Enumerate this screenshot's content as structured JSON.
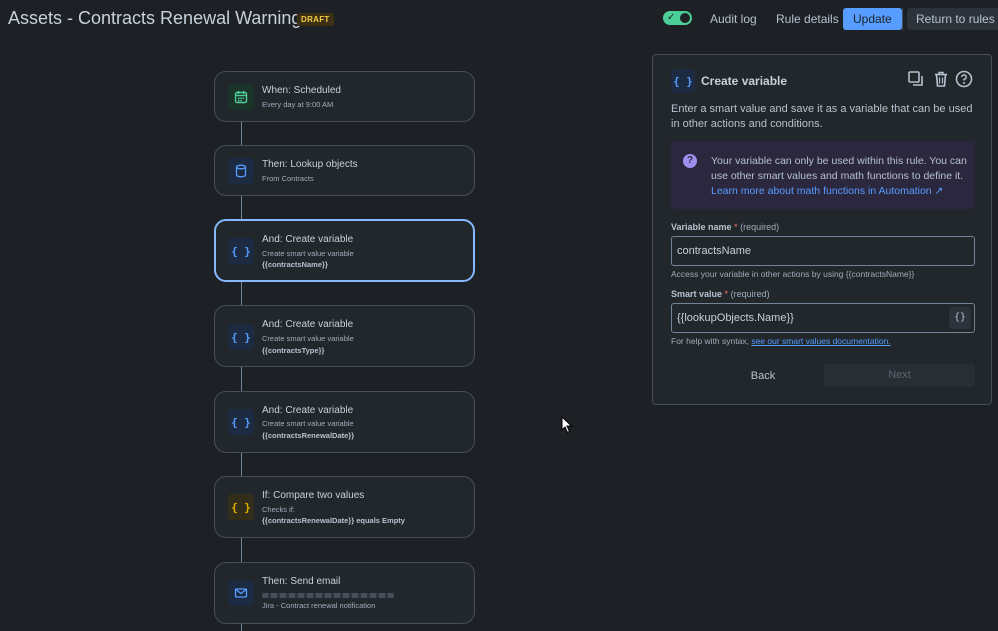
{
  "header": {
    "title": "Assets - Contracts Renewal Warning",
    "badge": "DRAFT",
    "toggle_enabled": true,
    "audit_log_label": "Audit log",
    "rule_details_label": "Rule details",
    "update_label": "Update",
    "return_label": "Return to rules"
  },
  "flow": {
    "nodes": [
      {
        "title": "When: Scheduled",
        "subtitle": "Every day at 9:00 AM",
        "icon": "calendar-icon"
      },
      {
        "title": "Then: Lookup objects",
        "subtitle": "From Contracts",
        "icon": "database-icon"
      },
      {
        "title": "And: Create variable",
        "subtitle": "Create smart value variable",
        "value": "{{contractsName}}",
        "icon": "braces-icon",
        "selected": true
      },
      {
        "title": "And: Create variable",
        "subtitle": "Create smart value variable",
        "value": "{{contractsType}}",
        "icon": "braces-icon"
      },
      {
        "title": "And: Create variable",
        "subtitle": "Create smart value variable",
        "value": "{{contractsRenewalDate}}",
        "icon": "braces-icon"
      },
      {
        "title": "If: Compare two values",
        "subtitle": "Checks if:",
        "value": "{{contractsRenewalDate}} equals Empty",
        "icon": "braces-icon"
      },
      {
        "title": "Then: Send email",
        "subtitle": "Jira - Contract renewal notification",
        "icon": "email-icon"
      }
    ]
  },
  "panel": {
    "title": "Create variable",
    "description": "Enter a smart value and save it as a variable that can be used in other actions and conditions.",
    "info_text": "Your variable can only be used within this rule. You can use other smart values and math functions to define it.",
    "info_link": "Learn more about math functions in Automation ↗",
    "variable_name_label": "Variable name",
    "required_marker": "*",
    "required_text": "(required)",
    "variable_name_value": "contractsName",
    "variable_help": "Access your variable in other actions by using {{contractsName}}",
    "smart_value_label": "Smart value",
    "smart_value_value": "{{lookupObjects.Name}}",
    "braces_glyph": "{}",
    "syntax_help": "For help with syntax,",
    "syntax_link": "see our smart values documentation.",
    "back_label": "Back",
    "next_label": "Next"
  },
  "colors": {
    "background": "#1d2125",
    "accent_blue": "#579dff",
    "toggle_green": "#4bce97",
    "badge_yellow": "#f5cd47",
    "info_bg": "#2b273f"
  }
}
